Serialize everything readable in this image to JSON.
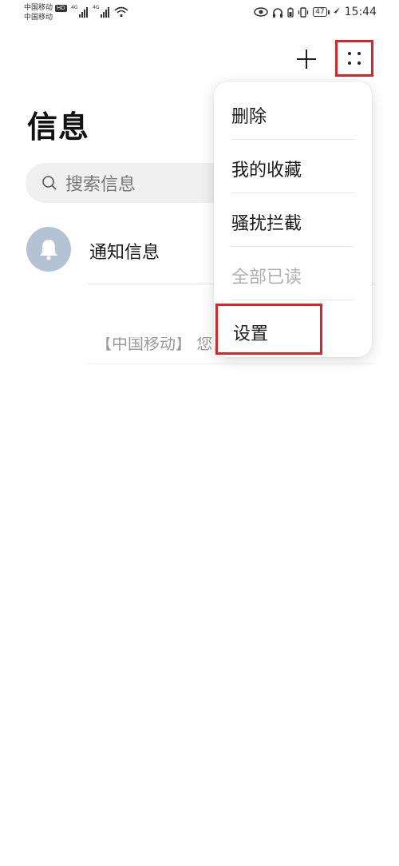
{
  "status_bar": {
    "carrier1": "中国移动",
    "carrier2": "中国移动",
    "hd": "HD",
    "net1": "4G",
    "net2": "4G",
    "battery": "47",
    "time": "15:44"
  },
  "title": "信息",
  "search": {
    "placeholder": "搜索信息"
  },
  "list": {
    "notify_label": "通知信息",
    "partial_text": "【中国移动】 您"
  },
  "menu": {
    "items": [
      {
        "label": "删除"
      },
      {
        "label": "我的收藏"
      },
      {
        "label": "骚扰拦截"
      },
      {
        "label": "全部已读"
      },
      {
        "label": "设置"
      }
    ]
  },
  "colors": {
    "highlight": "#d5262b",
    "avatar_bg": "#b3c3d3"
  },
  "icons": {
    "add": "plus-icon",
    "more": "more-dots-icon",
    "search": "search-icon",
    "avatar": "bell-icon"
  }
}
